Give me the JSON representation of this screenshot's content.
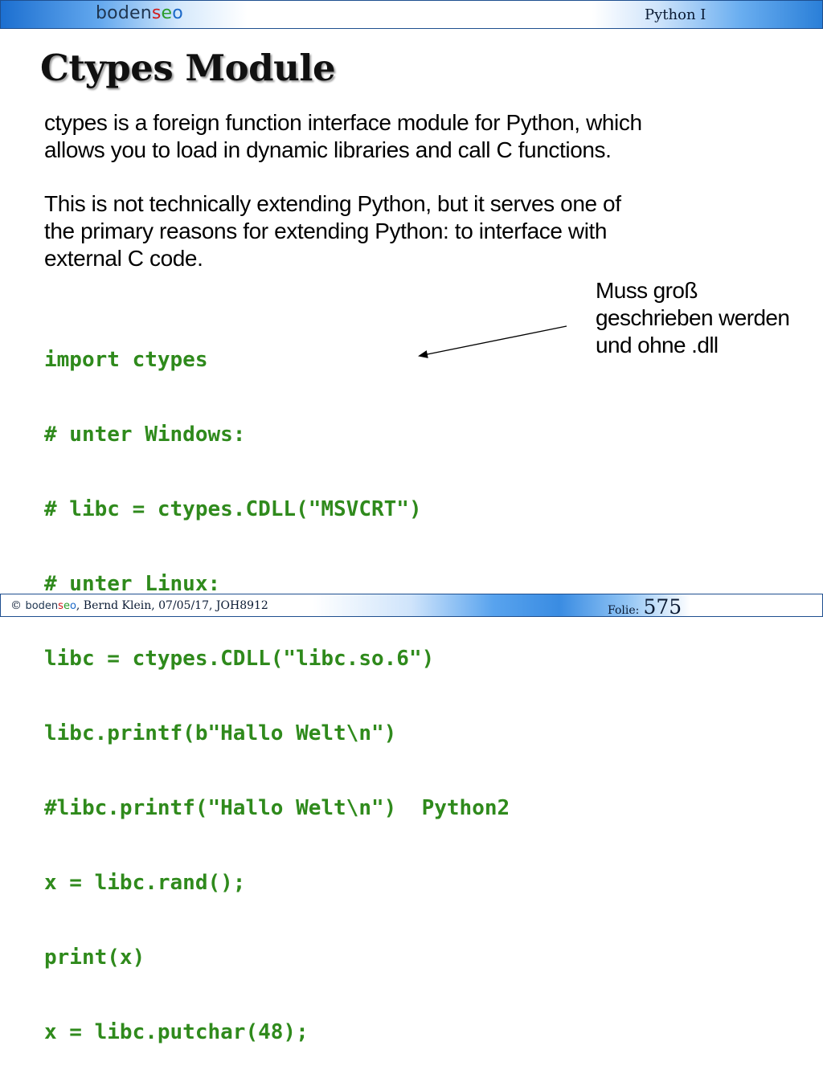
{
  "header": {
    "logo_part1": "boden",
    "logo_s": "s",
    "logo_e": "e",
    "logo_o": "o",
    "course": "Python I"
  },
  "slide": {
    "title": "Ctypes Module",
    "paragraph1_line1": "ctypes is a foreign function interface module for Python, which",
    "paragraph1_line2": "allows you to load in dynamic libraries and call C functions.",
    "paragraph2_line1": "This is not technically extending Python, but it serves one of",
    "paragraph2_line2": "the primary reasons for extending Python: to interface with",
    "paragraph2_line3": "external C code.",
    "code_lines": [
      "import ctypes",
      "# unter Windows:",
      "# libc = ctypes.CDLL(\"MSVCRT\")",
      "# unter Linux:",
      "libc = ctypes.CDLL(\"libc.so.6\")",
      "libc.printf(b\"Hallo Welt\\n\")",
      "#libc.printf(\"Hallo Welt\\n\")  Python2",
      "x = libc.rand();",
      "print(x)",
      "x = libc.putchar(48);"
    ],
    "annotation_lines": [
      "Muss groß",
      "geschrieben werden",
      "und ohne .dll"
    ],
    "code_color": "#2f8a1c"
  },
  "footer": {
    "copyright": "©",
    "logo_part1": "boden",
    "logo_s": "s",
    "logo_e": "e",
    "logo_o": "o",
    "author_text": ", Bernd Klein, 07/05/17, JOH8912",
    "folio_label": "Folie:",
    "folio_number": "575"
  }
}
